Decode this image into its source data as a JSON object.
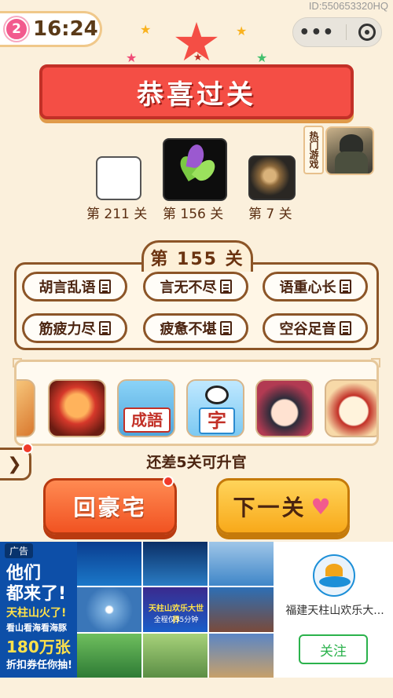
{
  "watermark": "ID:550653320HQ",
  "status": {
    "lives": "2",
    "time": "16:24"
  },
  "capsule": {
    "more_icon": "more-dots-icon",
    "close_icon": "target-circle-icon"
  },
  "banner": {
    "title": "恭喜过关"
  },
  "hot_games": {
    "label": "热门游戏"
  },
  "levels": [
    {
      "label": "第 211 关"
    },
    {
      "label": "第 156 关"
    },
    {
      "label": "第 7 关"
    }
  ],
  "current_level": "第 155 关",
  "idioms": [
    "胡言乱语",
    "言无不尽",
    "语重心长",
    "筋疲力尽",
    "疲惫不堪",
    "空谷足音"
  ],
  "games": [
    {
      "name": "monkey-king-game"
    },
    {
      "name": "chengyu-game",
      "text": "成語"
    },
    {
      "name": "panda-zi-game",
      "text": "字"
    },
    {
      "name": "girl-character-game"
    },
    {
      "name": "scholar-game"
    }
  ],
  "promo": "还差5关可升官",
  "buttons": {
    "home": "回豪宅",
    "next": "下一关"
  },
  "ad": {
    "tag": "广告",
    "lines": [
      "他们",
      "都来了!",
      "天柱山火了!",
      "看山看海看海豚",
      "180万张",
      "折扣券任你抽!"
    ],
    "advertiser": "福建天柱山欢乐大...",
    "follow": "关注",
    "grid_texts": [
      "天柱山欢乐大世界",
      "全程仅35分钟"
    ]
  },
  "colors": {
    "banner_red": "#f44e45",
    "home_orange": "#f15322",
    "next_yellow": "#f8a91a",
    "follow_green": "#2bb24c"
  }
}
